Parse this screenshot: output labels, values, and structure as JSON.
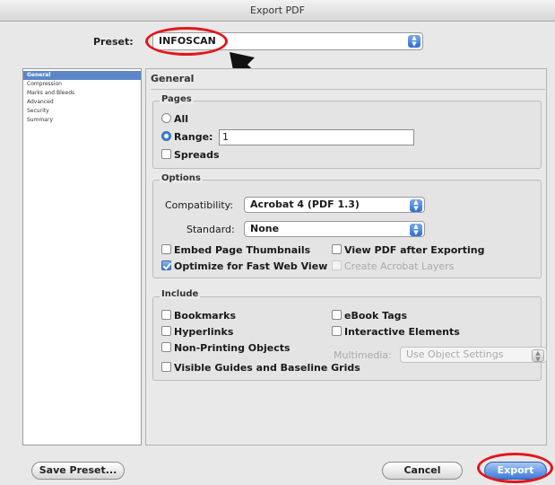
{
  "window": {
    "title": "Export PDF"
  },
  "preset": {
    "label": "Preset:",
    "value": "INFOSCAN"
  },
  "sidebar": {
    "items": [
      {
        "label": "General",
        "selected": true
      },
      {
        "label": "Compression",
        "selected": false
      },
      {
        "label": "Marks and Bleeds",
        "selected": false
      },
      {
        "label": "Advanced",
        "selected": false
      },
      {
        "label": "Security",
        "selected": false
      },
      {
        "label": "Summary",
        "selected": false
      }
    ]
  },
  "panel": {
    "title": "General"
  },
  "pages": {
    "title": "Pages",
    "all_label": "All",
    "range_label": "Range:",
    "range_value": "1",
    "spreads_label": "Spreads"
  },
  "options": {
    "title": "Options",
    "compatibility_label": "Compatibility:",
    "compatibility_value": "Acrobat 4 (PDF 1.3)",
    "standard_label": "Standard:",
    "standard_value": "None",
    "embed_thumbnails_label": "Embed Page Thumbnails",
    "view_pdf_label": "View PDF after Exporting",
    "optimize_label": "Optimize for Fast Web View",
    "create_layers_label": "Create Acrobat Layers"
  },
  "include": {
    "title": "Include",
    "bookmarks_label": "Bookmarks",
    "ebook_tags_label": "eBook Tags",
    "hyperlinks_label": "Hyperlinks",
    "interactive_label": "Interactive Elements",
    "non_printing_label": "Non-Printing Objects",
    "multimedia_label": "Multimedia:",
    "multimedia_value": "Use Object Settings",
    "guides_label": "Visible Guides and Baseline Grids"
  },
  "buttons": {
    "save_preset": "Save Preset...",
    "cancel": "Cancel",
    "export": "Export"
  },
  "colors": {
    "annotation": "#e3161b",
    "accent": "#3b79d9"
  }
}
